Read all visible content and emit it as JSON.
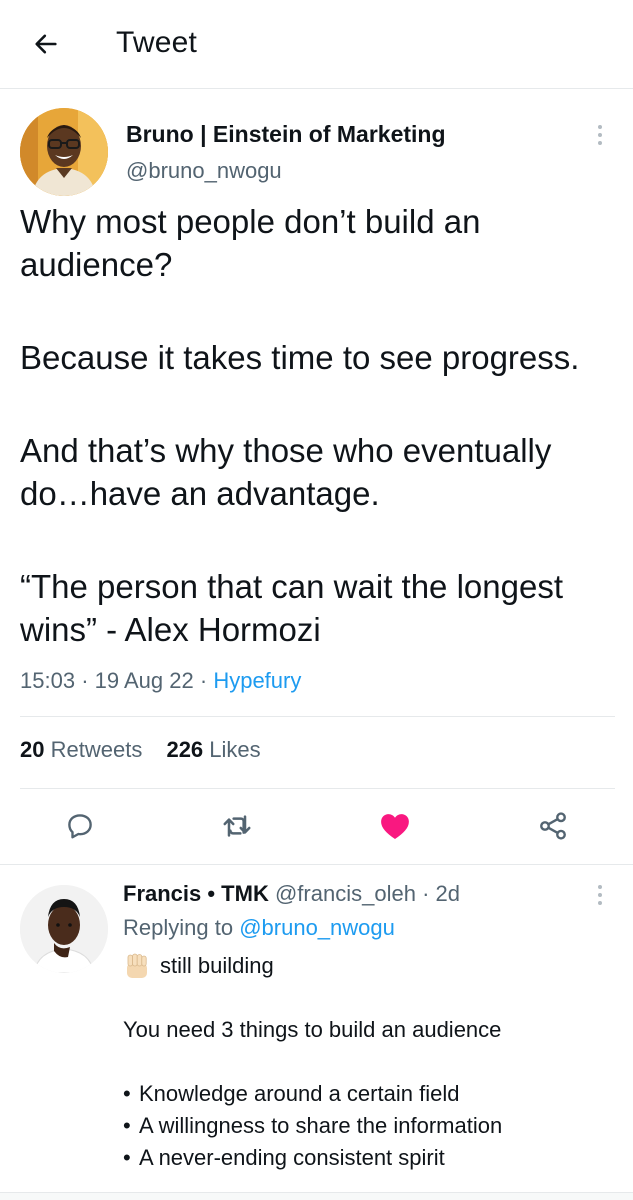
{
  "header": {
    "title": "Tweet",
    "back_icon": "arrow-left-icon"
  },
  "tweet": {
    "author_name": "Bruno | Einstein of Marketing",
    "author_handle": "@bruno_nwogu",
    "text": {
      "p1": "Why most people don’t build an audience?",
      "p2": "Because it takes time to see progress.",
      "p3": "And that’s why those who eventually do…have an advantage.",
      "p4": "“The person that can wait the longest wins” - Alex Hormozi"
    },
    "time": "15:03",
    "date": "19 Aug 22",
    "separator": "·",
    "source": "Hypefury",
    "retweets_count": "20",
    "retweets_label": "Retweets",
    "likes_count": "226",
    "likes_label": "Likes",
    "liked": true,
    "like_color": "#f91880"
  },
  "actions": [
    "reply-icon",
    "retweet-icon",
    "like-icon",
    "share-icon"
  ],
  "reply": {
    "author_name": "Francis • TMK",
    "author_handle": "@francis_oleh",
    "time_ago": "· 2d",
    "replying_prefix": "Replying to",
    "replying_to": "@bruno_nwogu",
    "line1": "still building",
    "line2": "You need 3 things to build an audience",
    "bullets": [
      "Knowledge around a certain field",
      "A willingness to share the information",
      "A never-ending consistent spirit"
    ],
    "bullet_char": "•"
  },
  "colors": {
    "text": "#0f1419",
    "muted": "#536471",
    "link": "#1d9bf0",
    "like": "#f91880"
  }
}
